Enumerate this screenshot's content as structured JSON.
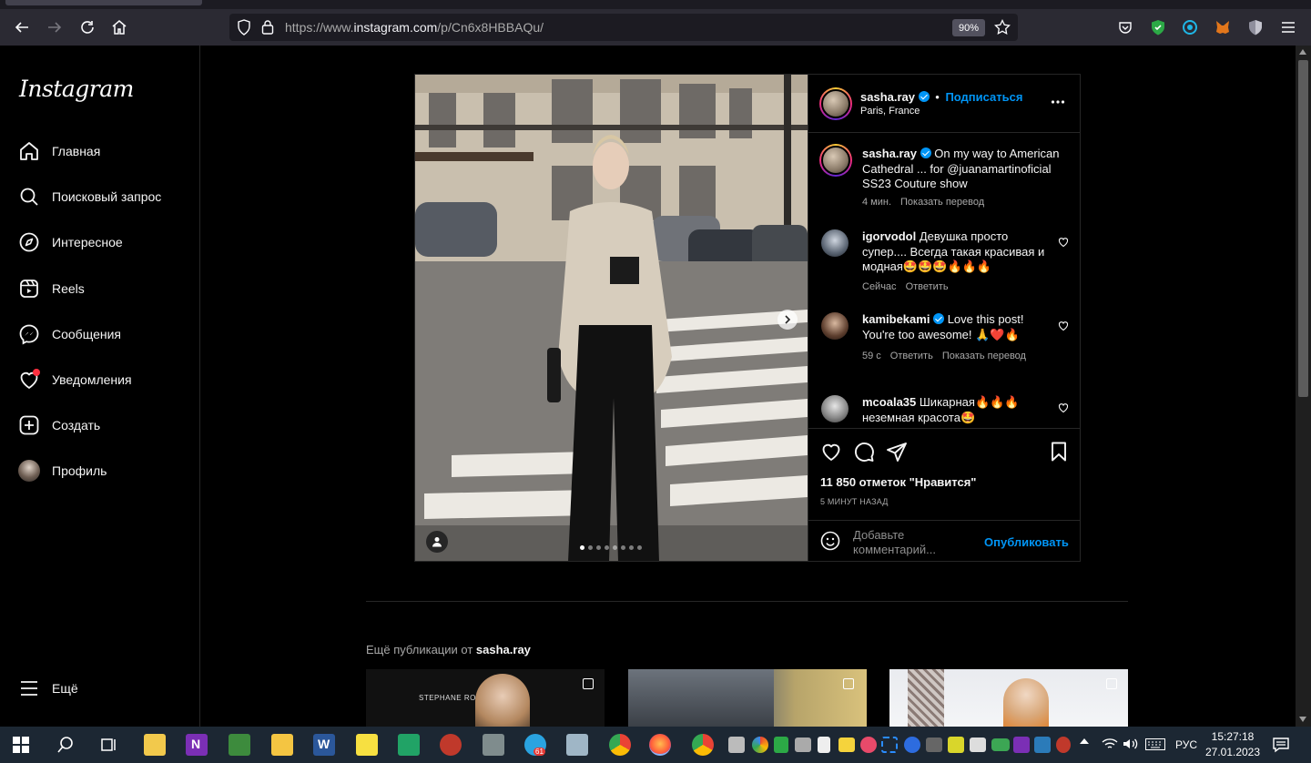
{
  "browser": {
    "url_prefix": "https://www.",
    "url_domain": "instagram.com",
    "url_path": "/p/Cn6x8HBBAQu/",
    "zoom": "90%"
  },
  "sidebar": {
    "logo": "Instagram",
    "items": [
      {
        "label": "Главная",
        "icon": "home-icon"
      },
      {
        "label": "Поисковый запрос",
        "icon": "search-icon"
      },
      {
        "label": "Интересное",
        "icon": "compass-icon"
      },
      {
        "label": "Reels",
        "icon": "reels-icon"
      },
      {
        "label": "Сообщения",
        "icon": "messenger-icon"
      },
      {
        "label": "Уведомления",
        "icon": "heart-icon"
      },
      {
        "label": "Создать",
        "icon": "plus-square-icon"
      },
      {
        "label": "Профиль",
        "icon": "avatar"
      }
    ],
    "more": "Ещё"
  },
  "post": {
    "author": "sasha.ray",
    "follow": "Подписаться",
    "location": "Paris, France",
    "caption": "On my way to American Cathedral ... for @juanamartinoficial SS23 Couture show",
    "caption_time": "4 мин.",
    "translate": "Показать перевод",
    "carousel_total": 8,
    "carousel_index": 1,
    "comments": [
      {
        "user": "igorvodol",
        "verified": false,
        "text": "Девушка просто супер.... Всегда такая красивая и модная🤩🤩🤩🔥🔥🔥",
        "time": "Сейчас",
        "reply": "Ответить",
        "translate": ""
      },
      {
        "user": "kamibekami",
        "verified": true,
        "text": "Love this post! You're too awesome! 🙏❤️🔥",
        "time": "59 с",
        "reply": "Ответить",
        "translate": "Показать перевод"
      },
      {
        "user": "mcoala35",
        "verified": false,
        "text": "Шикарная🔥🔥🔥 неземная красота🤩",
        "time": "",
        "reply": "",
        "translate": ""
      }
    ],
    "likes": "11 850 отметок \"Нравится\"",
    "posted": "5 МИНУТ НАЗАД",
    "comment_placeholder": "Добавьте комментарий...",
    "publish": "Опубликовать"
  },
  "more_posts": {
    "label": "Ещё публикации от",
    "author": "sasha.ray",
    "thumb1_text": "STEPHANE ROLLAND"
  },
  "taskbar": {
    "lang": "РУС",
    "time": "15:27:18",
    "date": "27.01.2023",
    "badge": "61"
  },
  "colors": {
    "accent": "#0095f6",
    "background": "#000000",
    "border": "#262626",
    "muted": "#a8a8a8"
  }
}
